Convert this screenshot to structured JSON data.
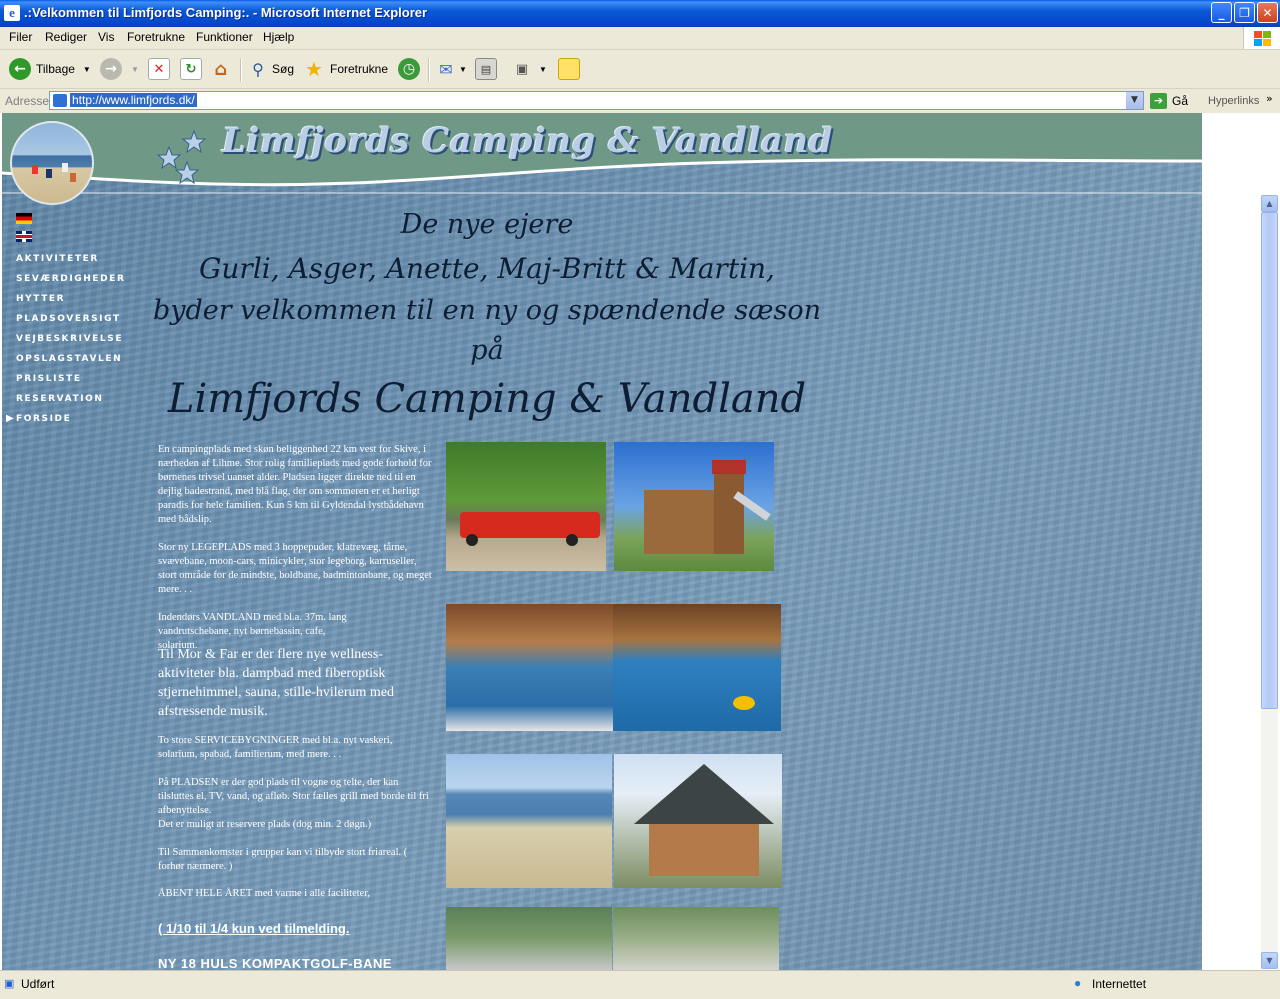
{
  "window": {
    "title": ".:Velkommen til Limfjords Camping:. - Microsoft Internet Explorer"
  },
  "menu": [
    "Filer",
    "Rediger",
    "Vis",
    "Foretrukne",
    "Funktioner",
    "Hjælp"
  ],
  "toolbar": {
    "back_label": "Tilbage",
    "search_label": "Søg",
    "favorites_label": "Foretrukne"
  },
  "address": {
    "label": "Adresse",
    "url": "http://www.limfjords.dk/",
    "go_label": "Gå",
    "links_label": "Hyperlinks"
  },
  "site": {
    "logo": "Limfjords Camping & Vandland",
    "nav": [
      "AKTIVITETER",
      "SEVÆRDIGHEDER",
      "HYTTER",
      "PLADSOVERSIGT",
      "VEJBESKRIVELSE",
      "OPSLAGSTAVLEN",
      "PRISLISTE",
      "RESERVATION",
      "FORSIDE"
    ],
    "headline": {
      "line1": "De nye ejere",
      "line2": "Gurli, Asger, Anette, Maj-Britt & Martin,",
      "line3": "byder velkommen til en ny og spændende sæson på",
      "line4": "Limfjords Camping & Vandland"
    },
    "paragraphs": {
      "p1": "En campingplads med skøn beliggenhed 22 km vest for Skive, i nærheden af Lihme. Stor rolig familieplads med gode forhold for børnenes trivsel uanset alder. Pladsen ligger direkte ned til en dejlig badestrand, med blå flag, der om sommeren er et herligt paradis for hele familien. Kun 5 km til Gyldendal lystbådehavn med bådslip.",
      "p2": "Stor ny LEGEPLADS med 3 hoppepuder, klatrevæg, tårne, svævebane, moon-cars, minicykler, stor legeborg, karruseller, stort område for de mindste, boldbane, badmintonbane, og meget mere. . .",
      "p3a": "Indendørs VANDLAND med bl.a. 37m. lang vandrutschebane, nyt børnebassin, cafe, solarium.",
      "p3b": "Til Mor & Far er der flere nye wellness-aktiviteter bla. dampbad med fiberoptisk stjernehimmel, sauna, stille-hvilerum med afstressende musik.",
      "p4": "To store SERVICEBYGNINGER med bl.a. nyt vaskeri, solarium, spabad, familierum, med mere. . .",
      "p5a": "På PLADSEN er der god plads til vogne og telte, der kan tilsluttes el, TV, vand, og afløb. Stor fælles grill med borde til fri afbenyttelse.",
      "p5b": "Det er muligt at reservere plads (dog min. 2 døgn.)",
      "p6": "Til Sammenkomster i grupper kan vi tilbyde stort friareal. ( forhør nærmere. )",
      "p7": "ÅBENT HELE ÅRET med varme i alle faciliteter,",
      "link": "( 1/10 til 1/4 kun ved tilmelding.",
      "golf": "NY 18 HULS KOMPAKTGOLF-BANE"
    }
  },
  "status": {
    "left": "Udført",
    "zone": "Internettet"
  },
  "colors": {
    "title_blue": "#0b58d6",
    "header_green": "#6f9887",
    "sea": "#6d93b3"
  }
}
